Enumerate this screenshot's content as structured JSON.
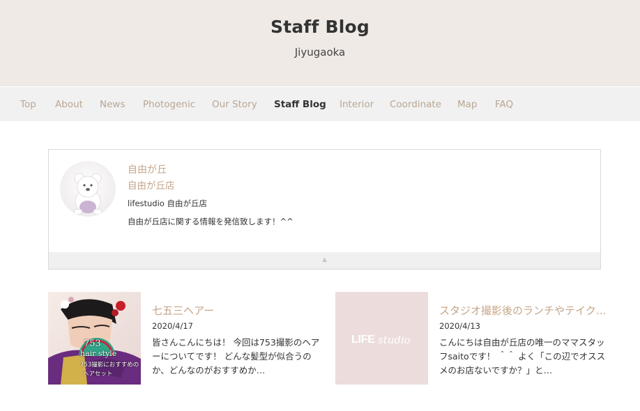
{
  "header": {
    "title": "Staff Blog",
    "subtitle": "Jiyugaoka"
  },
  "nav": {
    "items": [
      {
        "label": "Top",
        "active": false
      },
      {
        "label": "About",
        "active": false
      },
      {
        "label": "News",
        "active": false
      },
      {
        "label": "Photogenic",
        "active": false
      },
      {
        "label": "Our Story",
        "active": false
      },
      {
        "label": "Staff Blog",
        "active": true
      },
      {
        "label": "Interior",
        "active": false
      },
      {
        "label": "Coordinate",
        "active": false
      },
      {
        "label": "Map",
        "active": false
      },
      {
        "label": "FAQ",
        "active": false
      }
    ]
  },
  "profile": {
    "name": "自由が丘",
    "shop": "自由が丘店",
    "studio": "lifestudio 自由が丘店",
    "description": "自由が丘店に関する情報を発信致します！^^",
    "toggle_icon": "▲"
  },
  "posts": [
    {
      "title": "七五三ヘアー",
      "date": "2020/4/17",
      "excerpt": "皆さんこんにちは！ 今回は753撮影のヘアーについてです！ どんな髪型が似合うのか、どんなのがおすすめか…",
      "thumb_overlay": [
        "753",
        "hair style",
        "753撮影におすすめの",
        "ヘアセット"
      ]
    },
    {
      "title": "スタジオ撮影後のランチやテイクアウト",
      "date": "2020/4/13",
      "excerpt": "こんにちは自由が丘店の唯一のママスタッフsaitoです！ ＾＾ よく「この辺でオススメのお店ないですか？」と…",
      "thumb_logo_main": "LIFE",
      "thumb_logo_script": "studio"
    }
  ],
  "colors": {
    "hero_bg": "#efeae6",
    "nav_bg": "#f1f1f1",
    "accent": "#c5a588",
    "thumb_pink": "#ecdcdc"
  }
}
